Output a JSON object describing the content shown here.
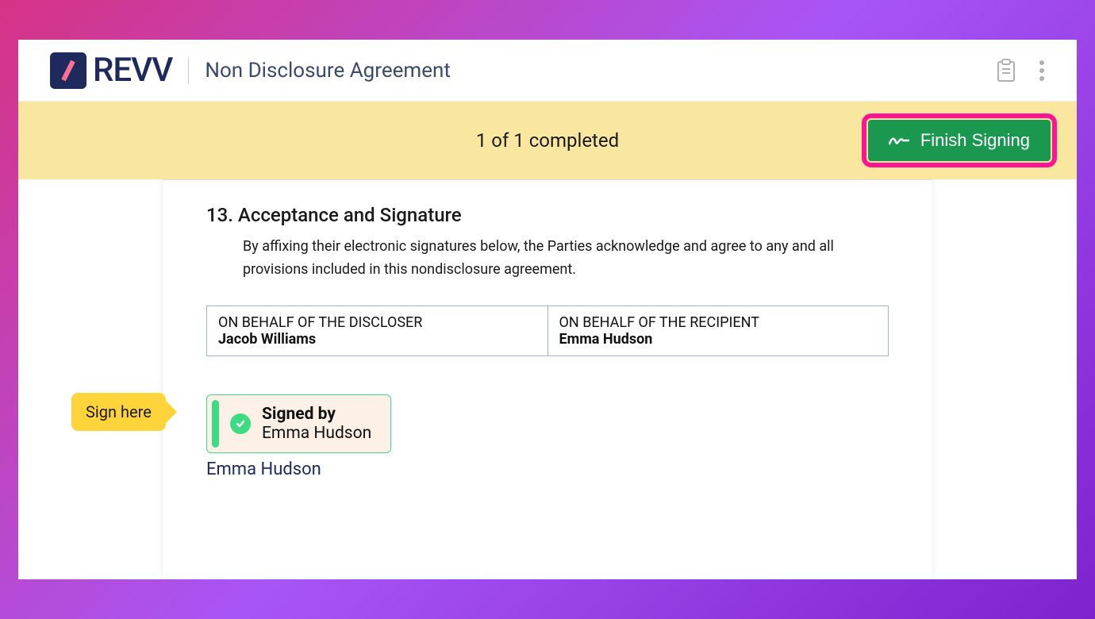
{
  "brand": "REVV",
  "doc_title": "Non Disclosure Agreement",
  "status": "1 of 1 completed",
  "finish_label": "Finish Signing",
  "section": {
    "number": "13.",
    "title": "Acceptance and Signature",
    "body": "By affixing their electronic signatures below, the Parties acknowledge and agree to any and all provisions included in this nondisclosure agreement."
  },
  "parties": {
    "left_label": "ON BEHALF OF THE DISCLOSER",
    "left_name": "Jacob Williams",
    "right_label": "ON BEHALF OF THE RECIPIENT",
    "right_name": "Emma Hudson"
  },
  "sign_here": "Sign here",
  "signed_by_label": "Signed by",
  "signed_by_name": "Emma Hudson",
  "signer": "Emma Hudson"
}
